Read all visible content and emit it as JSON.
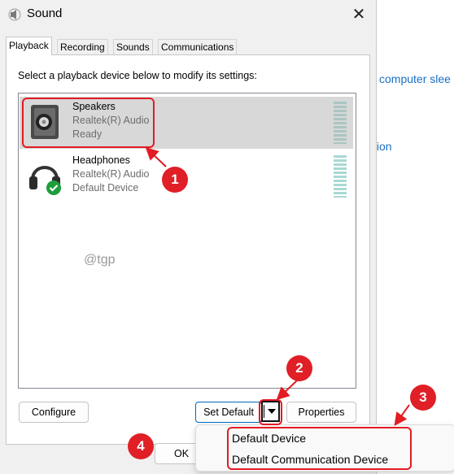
{
  "window": {
    "title": "Sound",
    "close_glyph": "✕"
  },
  "background": {
    "link1": "computer slee",
    "link2": "tion"
  },
  "tabs": [
    {
      "label": "Playback",
      "active": true
    },
    {
      "label": "Recording",
      "active": false
    },
    {
      "label": "Sounds",
      "active": false
    },
    {
      "label": "Communications",
      "active": false
    }
  ],
  "instruction": "Select a playback device below to modify its settings:",
  "devices": [
    {
      "name": "Speakers",
      "driver": "Realtek(R) Audio",
      "status": "Ready",
      "icon": "speaker-icon",
      "selected": true
    },
    {
      "name": "Headphones",
      "driver": "Realtek(R) Audio",
      "status": "Default Device",
      "icon": "headphones-icon",
      "selected": false
    }
  ],
  "watermark": "@tgp",
  "buttons": {
    "configure": "Configure",
    "set_default": "Set Default",
    "properties": "Properties",
    "ok": "OK"
  },
  "dropdown": {
    "items": [
      "Default Device",
      "Default Communication Device"
    ]
  },
  "annotations": [
    "1",
    "2",
    "3",
    "4"
  ],
  "colors": {
    "annotation": "#e31b23",
    "link": "#1a6fc4",
    "accent": "#0067c0"
  }
}
